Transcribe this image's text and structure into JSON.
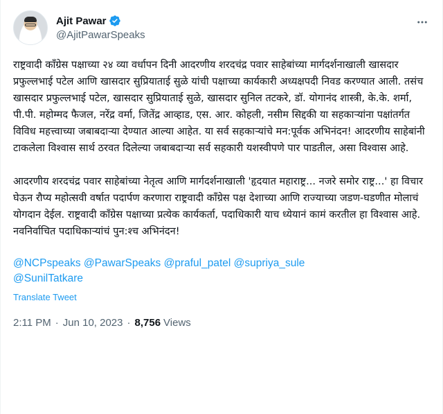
{
  "author": {
    "display_name": "Ajit Pawar",
    "handle": "@AjitPawarSpeaks",
    "verified_icon": "verified-badge-icon",
    "avatar": "profile-photo"
  },
  "more_icon": "more-horizontal-icon",
  "body": {
    "paragraph1": "राष्ट्रवादी काँग्रेस पक्षाच्या २४ व्या वर्धापन दिनी आदरणीय शरदचंद्र पवार साहेबांच्या मार्गदर्शनाखाली खासदार प्रफुल्लभाई पटेल आणि खासदार सुप्रियाताई सुळे यांची पक्षाच्या कार्यकारी अध्यक्षपदी निवड करण्यात आली. तसंच खासदार प्रफुल्लभाई पटेल, खासदार सुप्रियाताई सुळे, खासदार सुनिल तटकरे, डॉ. योगानंद शास्त्री, के.के. शर्मा, पी.पी. महोम्मद फैजल, नरेंद्र वर्मा, जितेंद्र आव्हाड, एस. आर. कोहली, नसीम सिद्दकी या सहकाऱ्यांना पक्षांतर्गत विविध महत्त्वाच्या जबाबदाऱ्या देण्यात आल्या आहेत. या सर्व सहकाऱ्यांचे मन:पूर्वक अभिनंदन! आदरणीय साहेबांनी टाकलेला विश्वास सार्थ ठरवत दिलेल्या जबाबदाऱ्या सर्व सहकारी यशस्वीपणे पार पाडतील, असा विश्वास आहे.",
    "paragraph2": "आदरणीय शरदचंद्र पवार साहेबांच्या नेतृत्व आणि मार्गदर्शनाखाली 'हृदयात महाराष्ट्र... नजरे समोर राष्ट्र...' हा विचार घेऊन रौप्य महोत्सवी वर्षात पदार्पण करणारा राष्ट्रवादी काँग्रेस पक्ष देशाच्या आणि राज्याच्या जडण-घडणीत मोलाचं योगदान देईल. राष्ट्रवादी काँग्रेस पक्षाच्या प्रत्येक कार्यकर्ता, पदाधिकारी याच ध्येयानं कामं करतील हा विश्वास आहे. नवनिर्वाचित पदाधिकाऱ्यांचं पुन:श्च अभिनंदन!"
  },
  "mentions": [
    "@NCPspeaks",
    "@PawarSpeaks",
    "@praful_patel",
    "@supriya_sule",
    "@SunilTatkare"
  ],
  "translate_label": "Translate Tweet",
  "meta": {
    "time": "2:11 PM",
    "separator": "·",
    "date": "Jun 10, 2023",
    "views_count": "8,756",
    "views_label": "Views"
  },
  "colors": {
    "link": "#1d9bf0",
    "text": "#0f1419",
    "secondary": "#536471",
    "verified": "#1d9bf0"
  }
}
